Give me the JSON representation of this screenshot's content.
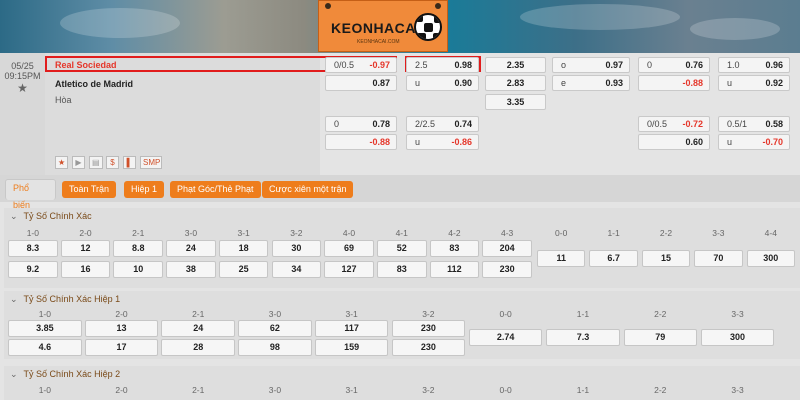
{
  "banner": {
    "logo_text": "KEONHACAI",
    "logo_sub": "KEONHACAI.COM"
  },
  "match": {
    "date": "05/25",
    "time": "09:15PM",
    "home": "Real Sociedad",
    "away": "Atletico de Madrid",
    "draw": "Hòa"
  },
  "odds_row1": {
    "hdp": {
      "line": "0/0.5",
      "value": "-0.97"
    },
    "ou": {
      "line": "2.5",
      "value": "0.98"
    },
    "x12": "2.35",
    "oe": {
      "label": "o",
      "value": "0.97"
    },
    "h1hdp": {
      "line": "0",
      "value": "0.76"
    },
    "h1ou": {
      "line": "1.0",
      "value": "0.96"
    }
  },
  "odds_row2": {
    "hdp": {
      "value": "0.87"
    },
    "ou": {
      "line": "u",
      "value": "0.90"
    },
    "x12": "2.83",
    "oe": {
      "label": "e",
      "value": "0.93"
    },
    "h1hdp": {
      "value": "-0.88"
    },
    "h1ou": {
      "line": "u",
      "value": "0.92"
    }
  },
  "odds_row3": {
    "x12": "3.35"
  },
  "odds_row4": {
    "hdp": {
      "line": "0",
      "value": "0.78"
    },
    "ou": {
      "line": "2/2.5",
      "value": "0.74"
    },
    "h1hdp": {
      "line": "0/0.5",
      "value": "-0.72"
    },
    "h1ou": {
      "line": "0.5/1",
      "value": "0.58"
    }
  },
  "odds_row5": {
    "hdp": {
      "value": "-0.88"
    },
    "ou": {
      "line": "u",
      "value": "-0.86"
    },
    "h1hdp": {
      "value": "0.60"
    },
    "h1ou": {
      "line": "u",
      "value": "-0.70"
    }
  },
  "icons": {
    "star": "★",
    "play": "▶",
    "stats": "▤",
    "money": "$",
    "lineup": "▌",
    "smp": "SMP"
  },
  "tabs": [
    "Phổ biến",
    "Toàn Trận",
    "Hiệp 1",
    "Phạt Góc/Thẻ Phạt",
    "Cược xiên một trận"
  ],
  "correct_score": {
    "title": "Tỷ Số Chính Xác",
    "labels": [
      "1-0",
      "2-0",
      "2-1",
      "3-0",
      "3-1",
      "3-2",
      "4-0",
      "4-1",
      "4-2",
      "4-3",
      "0-0",
      "1-1",
      "2-2",
      "3-3",
      "4-4"
    ],
    "row1": [
      "8.3",
      "12",
      "8.8",
      "24",
      "18",
      "30",
      "69",
      "52",
      "83",
      "204"
    ],
    "row2": [
      "9.2",
      "16",
      "10",
      "38",
      "25",
      "34",
      "127",
      "83",
      "112",
      "230"
    ],
    "draws": [
      "11",
      "6.7",
      "15",
      "70",
      "300"
    ]
  },
  "correct_score_h1": {
    "title": "Tỷ Số Chính Xác Hiệp 1",
    "labels": [
      "1-0",
      "2-0",
      "2-1",
      "3-0",
      "3-1",
      "3-2",
      "0-0",
      "1-1",
      "2-2",
      "3-3"
    ],
    "row1": [
      "3.85",
      "13",
      "24",
      "62",
      "117",
      "230"
    ],
    "row2": [
      "4.6",
      "17",
      "28",
      "98",
      "159",
      "230"
    ],
    "draws": [
      "2.74",
      "7.3",
      "79",
      "300"
    ]
  },
  "correct_score_h2": {
    "title": "Tỷ Số Chính Xác Hiệp 2",
    "labels": [
      "1-0",
      "2-0",
      "2-1",
      "3-0",
      "3-1",
      "3-2",
      "0-0",
      "1-1",
      "2-2",
      "3-3"
    ]
  }
}
